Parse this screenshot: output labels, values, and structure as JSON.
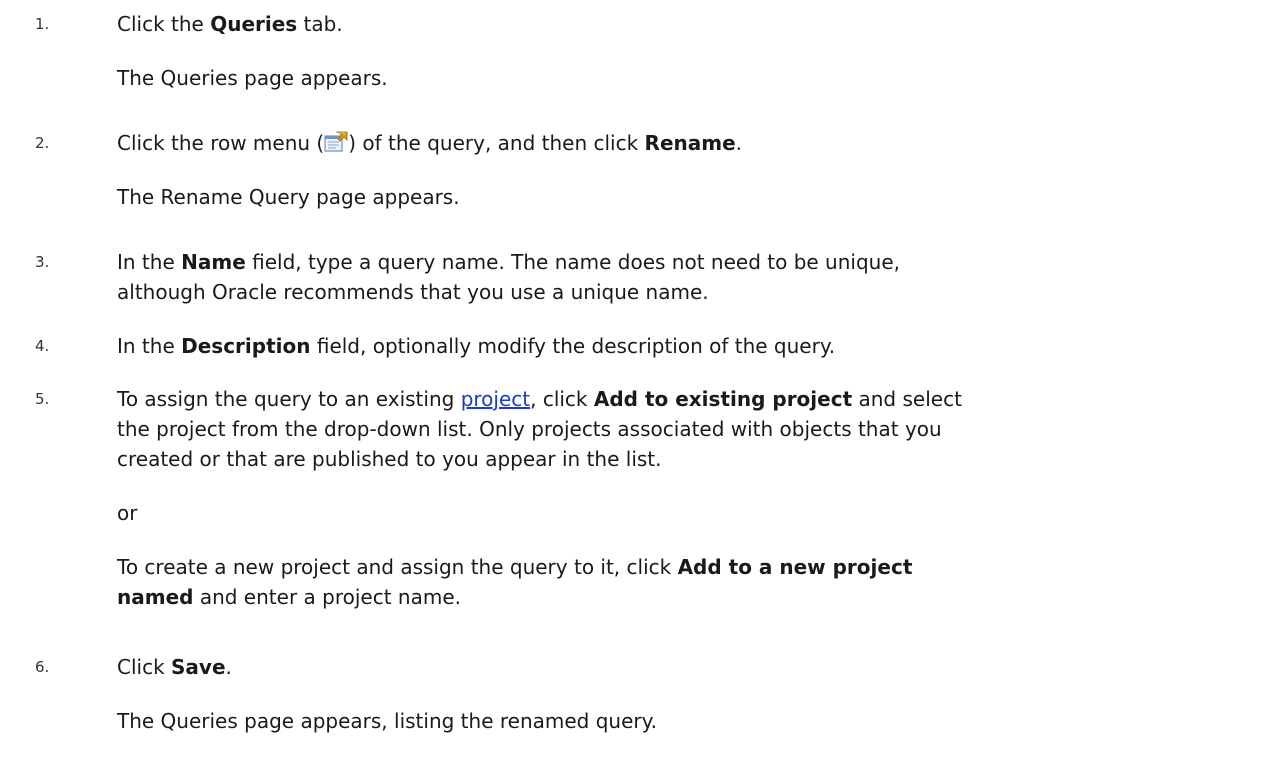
{
  "steps": [
    {
      "number": "1.",
      "pre": "Click the ",
      "bold": "Queries",
      "post": " tab.",
      "result": "The Queries page appears."
    },
    {
      "number": "2.",
      "pre": "Click the row menu (",
      "icon": "row-menu-icon",
      "mid": ") of the query, and then click ",
      "bold": "Rename",
      "post": ".",
      "result": "The Rename Query page appears."
    },
    {
      "number": "3.",
      "pre": "In the ",
      "bold": "Name",
      "post": " field, type a query name. The name does not need to be unique,",
      "line2": "although Oracle recommends that you use a unique name."
    },
    {
      "number": "4.",
      "pre": "In the ",
      "bold": "Description",
      "post": " field, optionally modify the description of the query."
    },
    {
      "number": "5.",
      "pre": "To assign the query to an existing ",
      "link": "project",
      "mid": ", click ",
      "bold": "Add to existing project",
      "post": " and select",
      "line2": "the project from the drop-down list. Only projects associated with objects that you",
      "line3": "created or that are published to you appear in the list.",
      "or": "or",
      "alt_pre": "To create a new project and assign the query to it, click ",
      "alt_bold1": "Add to a new project",
      "alt_bold2": "named",
      "alt_post": " and enter a project name."
    },
    {
      "number": "6.",
      "pre": "Click ",
      "bold": "Save",
      "post": ".",
      "result": "The Queries page appears, listing the renamed query."
    }
  ],
  "colors": {
    "link": "#1a3cc8",
    "text": "#1a1a1a"
  }
}
